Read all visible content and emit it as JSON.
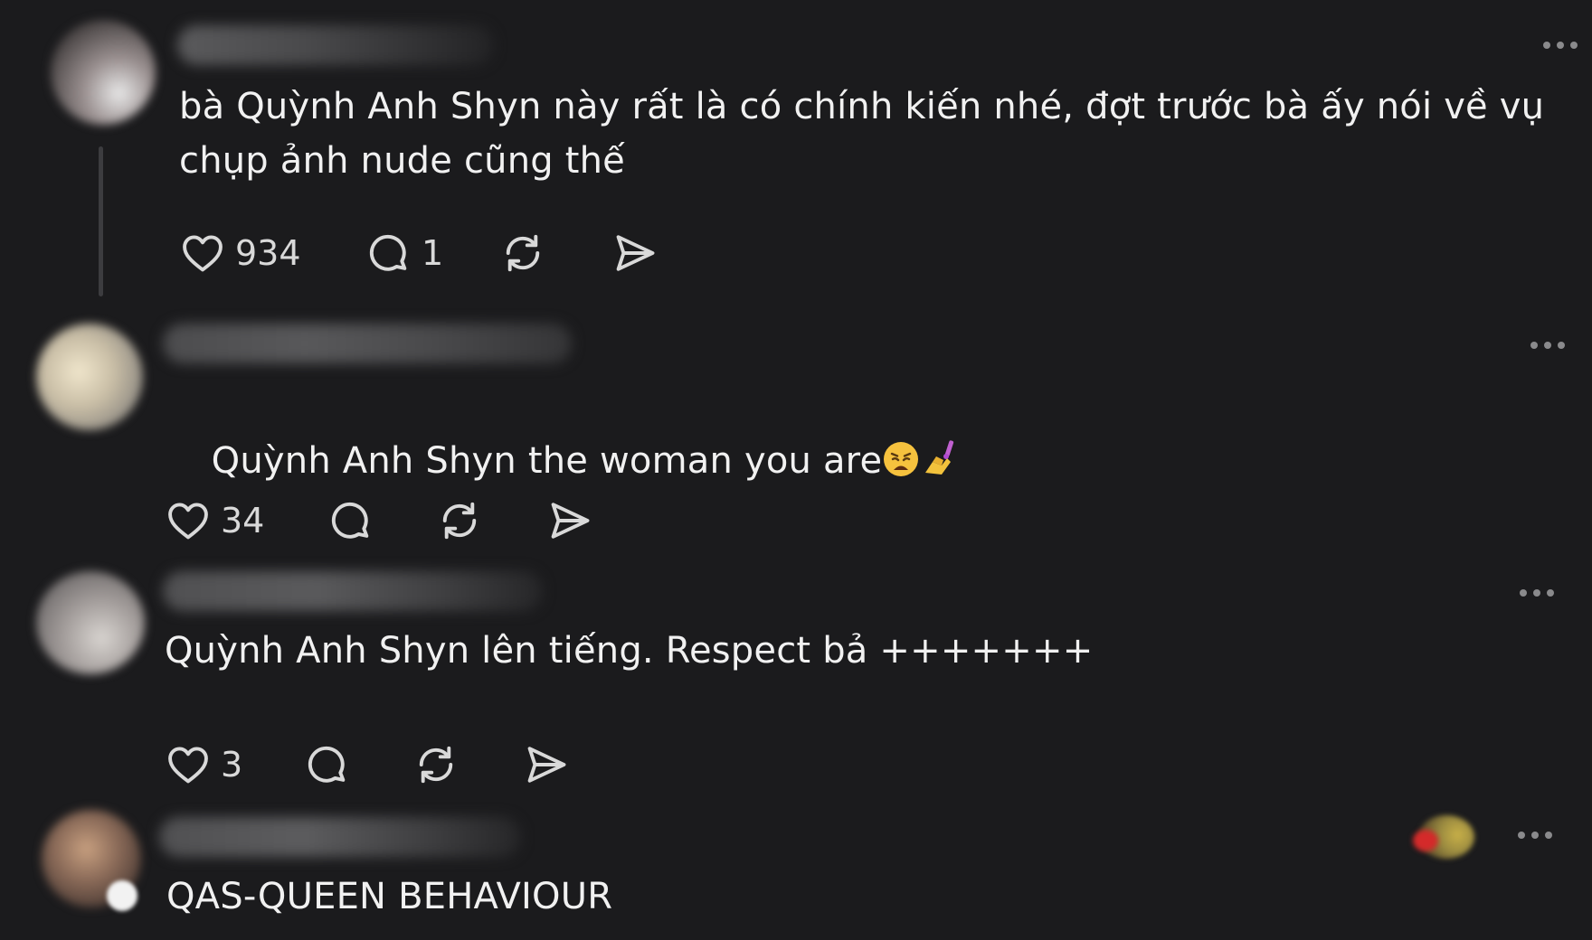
{
  "colors": {
    "background": "#1b1b1d",
    "text": "#f1f1f1",
    "icon": "#d9d9d9",
    "muted": "#8a8a8c"
  },
  "posts": [
    {
      "text": "bà Quỳnh Anh Shyn này rất là có chính kiến nhé, đợt trước bà ấy nói về vụ chụp ảnh nude cũng thế",
      "likes": "934",
      "replies": "1",
      "icons": [
        "heart-icon",
        "comment-icon",
        "repost-icon",
        "share-icon"
      ]
    },
    {
      "text": "Quỳnh Anh Shyn the woman you are",
      "emojis": [
        "weary-face-emoji",
        "nail-polish-emoji"
      ],
      "likes": "34",
      "replies": "",
      "icons": [
        "heart-icon",
        "comment-icon",
        "repost-icon",
        "share-icon"
      ]
    },
    {
      "text": "Quỳnh Anh Shyn lên tiếng. Respect bả +++++++",
      "likes": "3",
      "replies": "",
      "icons": [
        "heart-icon",
        "comment-icon",
        "repost-icon",
        "share-icon"
      ]
    },
    {
      "text": "QAS-QUEEN BEHAVIOUR",
      "icons": [
        "more-icon"
      ]
    }
  ]
}
